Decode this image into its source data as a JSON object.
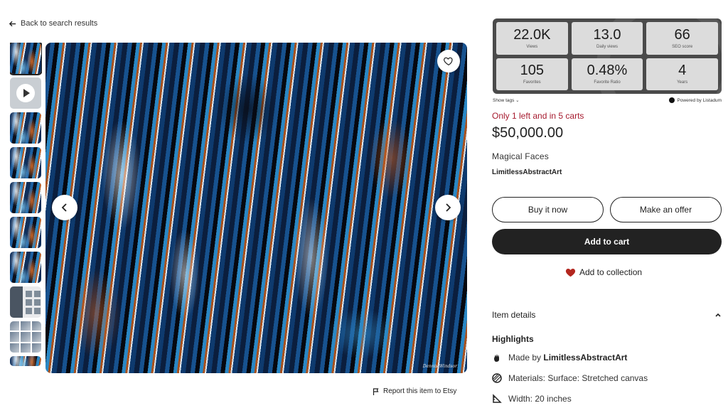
{
  "nav": {
    "back_label": "Back to search results"
  },
  "gallery": {
    "thumb_count": 10,
    "report_label": "Report this item to Etsy",
    "signature": "Dennis Windsor"
  },
  "stats": [
    {
      "value": "22.0K",
      "label": "Views"
    },
    {
      "value": "13.0",
      "label": "Daily views"
    },
    {
      "value": "66",
      "label": "SEO score"
    },
    {
      "value": "105",
      "label": "Favorites"
    },
    {
      "value": "0.48%",
      "label": "Favorite Ratio"
    },
    {
      "value": "4",
      "label": "Years"
    }
  ],
  "stats_footer": {
    "show_tags": "Show tags",
    "powered_by": "Powered by Listadum"
  },
  "listing": {
    "stock_notice": "Only 1 left and in 5 carts",
    "price": "$50,000.00",
    "title": "Magical Faces",
    "shop_name": "LimitlessAbstractArt"
  },
  "actions": {
    "buy_now": "Buy it now",
    "make_offer": "Make an offer",
    "add_to_cart": "Add to cart",
    "add_to_collection": "Add to collection"
  },
  "details": {
    "heading": "Item details",
    "highlights_heading": "Highlights",
    "made_by_prefix": "Made by",
    "made_by_shop": "LimitlessAbstractArt",
    "materials": "Materials: Surface: Stretched canvas",
    "width": "Width: 20 inches"
  },
  "colors": {
    "stock_red": "#a61a2e",
    "button_dark": "#222222",
    "heart_red": "#b3261e",
    "stats_panel": "#4a4a4a"
  }
}
